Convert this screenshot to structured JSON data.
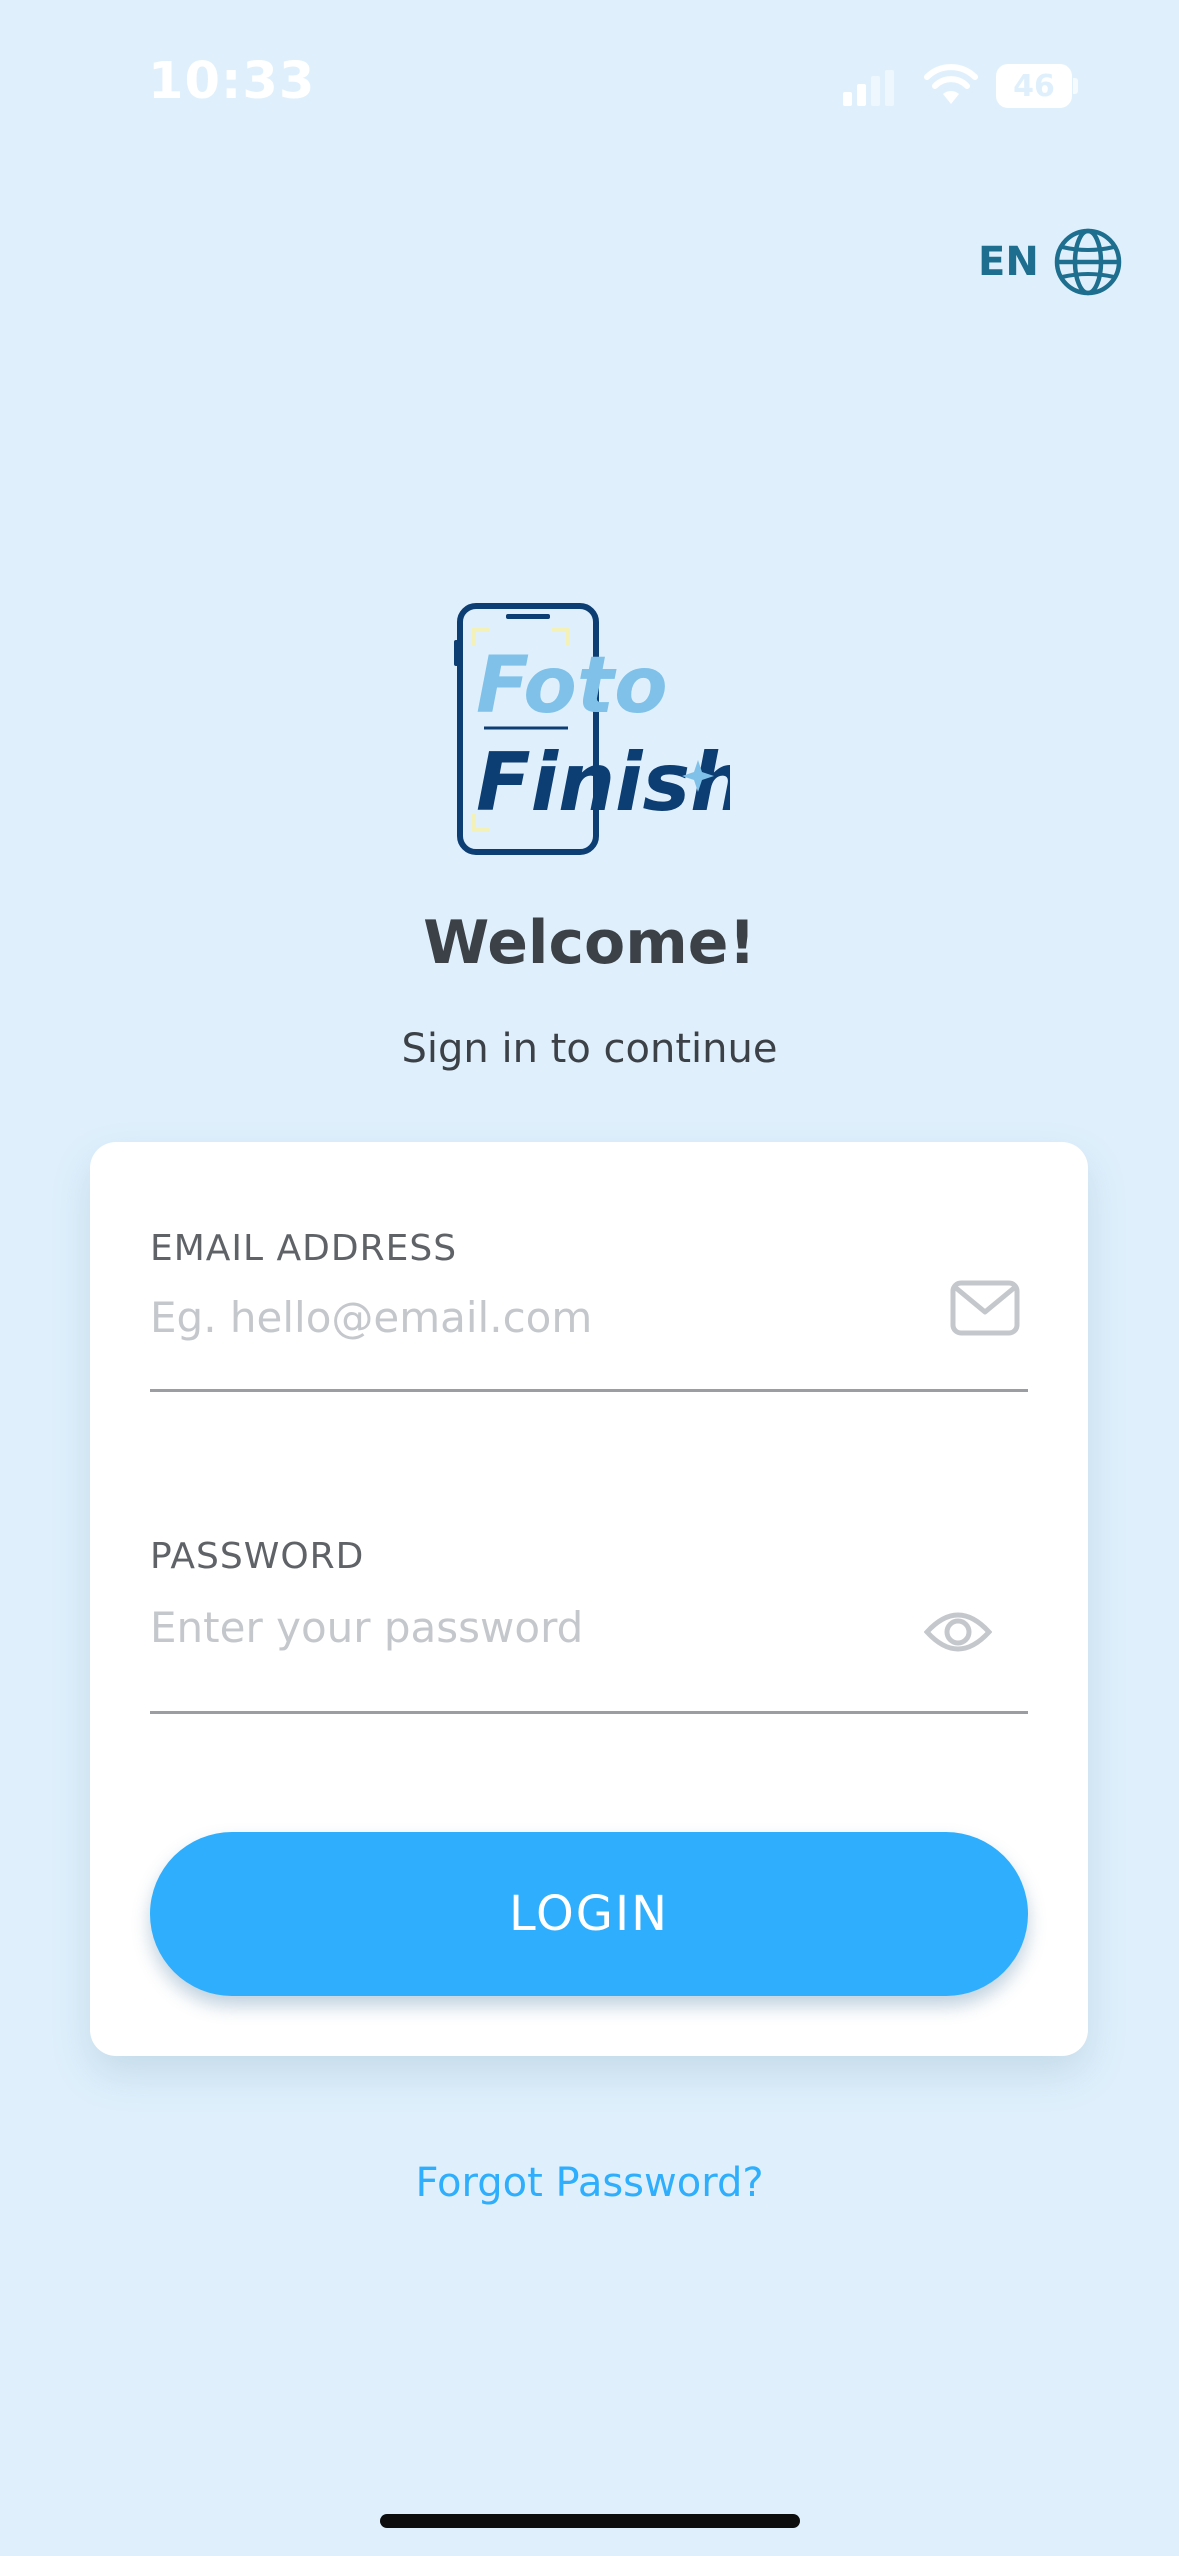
{
  "status_bar": {
    "time": "10:33",
    "battery_level": "46"
  },
  "language": {
    "code": "EN"
  },
  "logo": {
    "word1": "Foto",
    "word2": "Finish"
  },
  "welcome": {
    "title": "Welcome!",
    "subtitle": "Sign in to continue"
  },
  "form": {
    "email": {
      "label": "EMAIL ADDRESS",
      "placeholder": "Eg. hello@email.com",
      "value": ""
    },
    "password": {
      "label": "PASSWORD",
      "placeholder": "Enter your password",
      "value": ""
    },
    "login_label": "LOGIN"
  },
  "forgot_password": "Forgot Password?",
  "icons": {
    "language": "globe-icon",
    "email": "mail-icon",
    "password_toggle": "eye-icon"
  },
  "colors": {
    "background": "#dff0fc",
    "primary": "#2eaefc",
    "dark_blue": "#0c3d73",
    "light_blue": "#7fc1e8",
    "text": "#3c4148"
  }
}
